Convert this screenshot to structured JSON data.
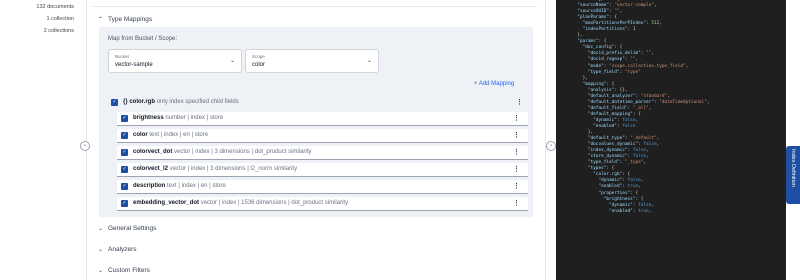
{
  "stats": {
    "documents": "132 documents",
    "collection": "1 collection",
    "collections": "2 collections"
  },
  "sections": {
    "type_mappings": "Type Mappings",
    "general_settings": "General Settings",
    "analyzers": "Analyzers",
    "custom_filters": "Custom Filters"
  },
  "mapping": {
    "from_label": "Map from Bucket / Scope:",
    "bucket_label": "Bucket",
    "bucket_value": "vector-sample",
    "scope_label": "Scope",
    "scope_value": "color",
    "add_mapping": "+  Add Mapping"
  },
  "root_field": {
    "name": "{} color.rgb",
    "desc": "only index specified child fields"
  },
  "fields": [
    {
      "name": "brightness",
      "desc": "number | index | store"
    },
    {
      "name": "color",
      "desc": "text | index | en | store"
    },
    {
      "name": "colorvect_dot",
      "desc": "vector | index | 3 dimensions | dot_product similarity"
    },
    {
      "name": "colorvect_l2",
      "desc": "vector | index | 3 dimensions | l2_norm similarity"
    },
    {
      "name": "description",
      "desc": "text | index | en | store"
    },
    {
      "name": "embedding_vector_dot",
      "desc": "vector | index | 1536 dimensions | dot_product similarity"
    }
  ],
  "side_tab": "Index Definition",
  "colors": {
    "accent": "#1e4fa3",
    "link": "#2563eb",
    "code_bg": "#1f1f1f"
  },
  "icons": {
    "kebab": "⋮",
    "chevron_down": "⌄",
    "chevron_up": "⌃",
    "check": "✓",
    "arrow_left": "‹",
    "arrow_right": "›"
  },
  "code_lines": [
    "  \"sourceType\": \"gocbcore\",",
    "  \"sourceName\": \"vector-sample\",",
    "  \"sourceUUID\": \"\",",
    "  \"planParams\": {",
    "    \"maxPartitionsPerPIndex\": 512,",
    "    \"indexPartitions\": 1",
    "  },",
    "  \"params\": {",
    "    \"doc_config\": {",
    "      \"docid_prefix_delim\": \"\",",
    "      \"docid_regexp\": \"\",",
    "      \"mode\": \"scope.collection.type_field\",",
    "      \"type_field\": \"type\"",
    "    },",
    "    \"mapping\": {",
    "      \"analysis\": {},",
    "      \"default_analyzer\": \"standard\",",
    "      \"default_datetime_parser\": \"dateTimeOptional\",",
    "      \"default_field\": \"_all\",",
    "      \"default_mapping\": {",
    "        \"dynamic\": false,",
    "        \"enabled\": false",
    "      },",
    "      \"default_type\": \"_default\",",
    "      \"docvalues_dynamic\": false,",
    "      \"index_dynamic\": false,",
    "      \"store_dynamic\": false,",
    "      \"type_field\": \"_type\",",
    "      \"types\": {",
    "        \"color.rgb\": {",
    "          \"dynamic\": false,",
    "          \"enabled\": true,",
    "          \"properties\": {",
    "            \"brightness\": {",
    "              \"dynamic\": false,",
    "              \"enabled\": true,"
  ]
}
